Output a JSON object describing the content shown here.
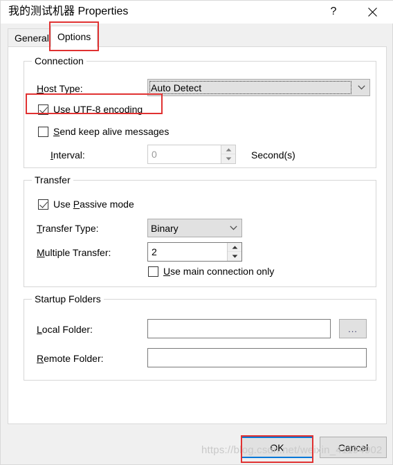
{
  "window": {
    "title": "我的测试机器 Properties",
    "help_label": "?",
    "close_label": "✕"
  },
  "tabs": [
    {
      "label": "General",
      "active": false
    },
    {
      "label": "Options",
      "active": true
    }
  ],
  "groups": {
    "connection": {
      "title": "Connection",
      "host_type_label": "Host Type:",
      "host_type_label_pre": "H",
      "host_type_label_post": "ost Type:",
      "host_type_value": "Auto Detect",
      "use_utf8_label_pre": "Use UTF-8 ",
      "use_utf8_label_mnemonic": "e",
      "use_utf8_label_post": "ncoding",
      "use_utf8_checked": true,
      "keep_alive_label_mnemonic": "S",
      "keep_alive_label_post": "end keep alive messages",
      "keep_alive_checked": false,
      "interval_label_mnemonic": "I",
      "interval_label_post": "nterval:",
      "interval_value": "0",
      "interval_unit": "Second(s)",
      "interval_enabled": false
    },
    "transfer": {
      "title": "Transfer",
      "passive_label_pre": "Use ",
      "passive_label_mnemonic": "P",
      "passive_label_post": "assive mode",
      "passive_checked": true,
      "transfer_type_label_mnemonic": "T",
      "transfer_type_label_post": "ransfer Type:",
      "transfer_type_value": "Binary",
      "multiple_transfer_label_mnemonic": "M",
      "multiple_transfer_label_post": "ultiple Transfer:",
      "multiple_transfer_value": "2",
      "main_connection_label_mnemonic": "U",
      "main_connection_label_post": "se main connection only",
      "main_connection_checked": false
    },
    "startup": {
      "title": "Startup Folders",
      "local_label_mnemonic": "L",
      "local_label_post": "ocal Folder:",
      "local_value": "",
      "browse_label": "...",
      "remote_label_mnemonic": "R",
      "remote_label_post": "emote Folder:",
      "remote_value": ""
    }
  },
  "footer": {
    "ok_label": "OK",
    "cancel_label": "Cancel"
  },
  "watermark": "https://blog.csdn.net/weixin_41194902",
  "colors": {
    "accent": "#0078d7",
    "annotation": "#e03131",
    "dialog_bg": "#f0f0f0",
    "page_bg": "#ffffff",
    "control_bg": "#e1e1e1"
  }
}
